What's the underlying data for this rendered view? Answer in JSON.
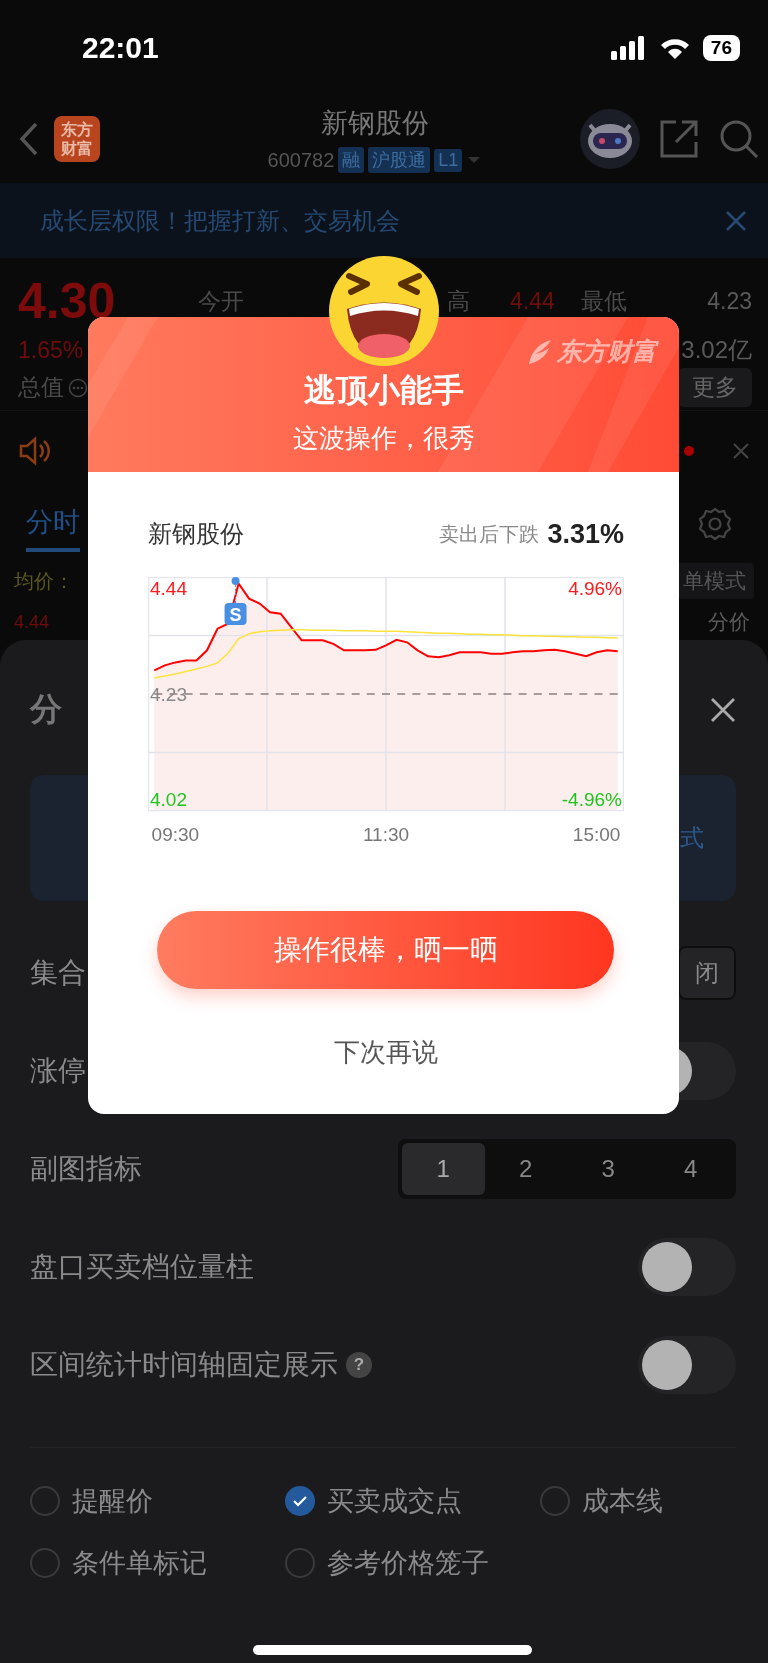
{
  "status_bar": {
    "time": "22:01",
    "battery": "76"
  },
  "nav": {
    "logo_text": "东方财富",
    "title": "新钢股份",
    "code": "600782",
    "tags": [
      "融",
      "沪股通",
      "L1"
    ]
  },
  "banner": {
    "text": "成长层权限！把握打新、交易机会"
  },
  "quote": {
    "price": "4.30",
    "change_pct": "1.65%",
    "open_label": "今开",
    "high_label": "高",
    "high_value": "4.44",
    "low_label": "最低",
    "low_value": "4.23",
    "amount": "3.02亿",
    "value_label": "总值",
    "more_button": "更多"
  },
  "tabs": [
    {
      "label": "分时",
      "selected": true
    }
  ],
  "avg_label": "均价：",
  "mode_button": "单模式",
  "price_label": "4.44",
  "split_label": "分价",
  "sheet": {
    "title": "分",
    "card_text": "式",
    "rows": [
      {
        "kind": "button",
        "label": "集合",
        "value": "闭"
      },
      {
        "kind": "toggle",
        "label": "涨停",
        "on": false
      },
      {
        "kind": "segments",
        "label": "副图指标",
        "options": [
          {
            "label": "1",
            "selected": true
          },
          {
            "label": "2",
            "selected": false
          },
          {
            "label": "3",
            "selected": false
          },
          {
            "label": "4",
            "selected": false
          }
        ]
      },
      {
        "kind": "toggle",
        "label": "盘口买卖档位量柱",
        "on": false
      },
      {
        "kind": "toggle",
        "label": "区间统计时间轴固定展示",
        "help": "?",
        "on": false
      }
    ],
    "checkboxes": [
      {
        "label": "提醒价",
        "checked": false
      },
      {
        "label": "买卖成交点",
        "checked": true
      },
      {
        "label": "成本线",
        "checked": false
      },
      {
        "label": "条件单标记",
        "checked": false
      },
      {
        "label": "参考价格笼子",
        "checked": false
      }
    ]
  },
  "modal": {
    "brand": "东方财富",
    "title": "逃顶小能手",
    "subtitle": "这波操作，很秀",
    "stock": "新钢股份",
    "result_label": "卖出后下跌",
    "result_value": "3.31%",
    "chart_data": {
      "type": "line",
      "categories": [
        null,
        null,
        "09:30",
        null,
        null,
        null,
        null,
        null,
        null,
        null,
        null,
        null,
        null,
        null,
        null,
        null,
        null,
        null,
        null,
        null,
        null,
        null,
        "11:30",
        null,
        null,
        null,
        null,
        null,
        null,
        null,
        null,
        null,
        null,
        null,
        null,
        null,
        null,
        null,
        null,
        null,
        null,
        null,
        "15:00",
        null,
        null
      ],
      "ylim": [
        3.997,
        4.463
      ],
      "yticks": [
        {
          "value": 4.44,
          "label": "4.44"
        },
        {
          "value": 4.23,
          "label": "4.23"
        },
        {
          "value": 4.02,
          "label": "4.02"
        }
      ],
      "series": [
        {
          "color": "#ff0000",
          "values": [
            4.277,
            4.287,
            4.293,
            4.297,
            4.297,
            4.317,
            4.36,
            4.37,
            4.45,
            4.42,
            4.41,
            4.393,
            4.39,
            4.363,
            4.337,
            4.337,
            4.337,
            4.33,
            4.317,
            4.317,
            4.317,
            4.318,
            4.327,
            4.338,
            4.333,
            4.317,
            4.305,
            4.303,
            4.307,
            4.313,
            4.313,
            4.313,
            4.31,
            4.31,
            4.313,
            4.315,
            4.315,
            4.317,
            4.318,
            4.315,
            4.31,
            4.305,
            4.313,
            4.317,
            4.315
          ]
        },
        {
          "color": "#ffe23d",
          "values": [
            4.262,
            4.266,
            4.27,
            4.275,
            4.28,
            4.285,
            4.292,
            4.311,
            4.34,
            4.35,
            4.354,
            4.356,
            4.357,
            4.358,
            4.358,
            4.357,
            4.357,
            4.357,
            4.356,
            4.356,
            4.356,
            4.355,
            4.355,
            4.355,
            4.354,
            4.353,
            4.352,
            4.351,
            4.351,
            4.35,
            4.349,
            4.349,
            4.348,
            4.348,
            4.347,
            4.346,
            4.346,
            4.345,
            4.345,
            4.344,
            4.344,
            4.343,
            4.343,
            4.342,
            4.342
          ]
        },
        {
          "color": "#8a8080",
          "line_style": "dashed",
          "values": [
            4.23,
            4.23,
            4.23,
            4.23,
            4.23,
            4.23,
            4.23,
            4.23,
            4.23,
            4.23,
            4.23,
            4.23,
            4.23,
            4.23,
            4.23,
            4.23,
            4.23,
            4.23,
            4.23,
            4.23,
            4.23,
            4.23,
            4.23,
            4.23,
            4.23,
            4.23,
            4.23,
            4.23,
            4.23,
            4.23,
            4.23,
            4.23,
            4.23,
            4.23,
            4.23,
            4.23,
            4.23,
            4.23,
            4.23,
            4.23,
            4.23,
            4.23,
            4.23,
            4.23,
            4.23
          ]
        }
      ],
      "annotations": [
        {
          "text": "S"
        }
      ]
    },
    "right_axis_labels": [
      "4.96%",
      "-4.96%"
    ],
    "primary_button": "操作很棒，晒一晒",
    "secondary_button": "下次再说"
  }
}
